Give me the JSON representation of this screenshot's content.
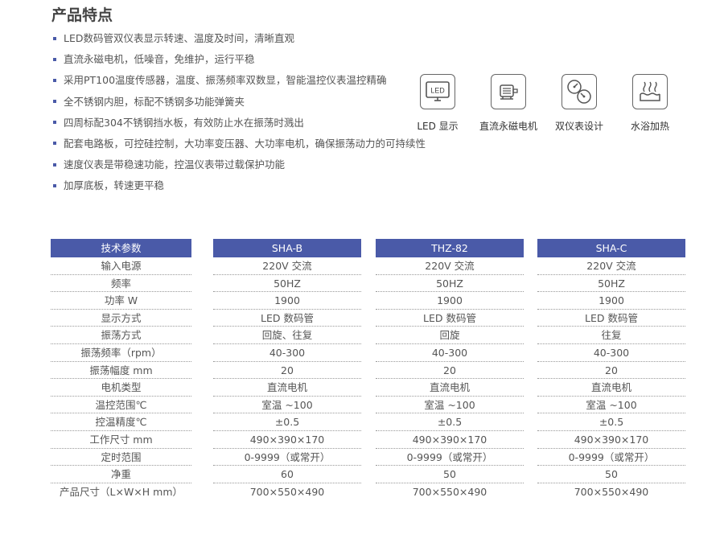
{
  "title": "产品特点",
  "features": [
    "LED数码管双仪表显示转速、温度及时间，清晰直观",
    "直流永磁电机，低噪音，免维护，运行平稳",
    "采用PT100温度传感器，温度、振荡频率双数显，智能温控仪表温控精确",
    "全不锈钢内胆，标配不锈钢多功能弹簧夹",
    "四周标配304不锈钢挡水板，有效防止水在振荡时溅出",
    "配套电路板，可控硅控制，大功率变压器、大功率电机，确保振荡动力的可持续性",
    "速度仪表是带稳速功能，控温仪表带过载保护功能",
    "加厚底板，转速更平稳"
  ],
  "icons": [
    {
      "label": "LED 显示",
      "icon": "led-display-icon",
      "text": "LED"
    },
    {
      "label": "直流永磁电机",
      "icon": "motor-icon"
    },
    {
      "label": "双仪表设计",
      "icon": "dual-gauge-icon"
    },
    {
      "label": "水浴加热",
      "icon": "water-bath-icon"
    }
  ],
  "table": {
    "headers": [
      "技术参数",
      "SHA-B",
      "THZ-82",
      "SHA-C"
    ],
    "rows": [
      [
        "输入电源",
        "220V 交流",
        "220V 交流",
        "220V 交流"
      ],
      [
        "频率",
        "50HZ",
        "50HZ",
        "50HZ"
      ],
      [
        "功率 W",
        "1900",
        "1900",
        "1900"
      ],
      [
        "显示方式",
        "LED 数码管",
        "LED 数码管",
        "LED 数码管"
      ],
      [
        "振荡方式",
        "回旋、往复",
        "回旋",
        "往复"
      ],
      [
        "振荡频率（rpm）",
        "40-300",
        "40-300",
        "40-300"
      ],
      [
        "振荡幅度 mm",
        "20",
        "20",
        "20"
      ],
      [
        "电机类型",
        "直流电机",
        "直流电机",
        "直流电机"
      ],
      [
        "温控范围℃",
        "室温 ~100",
        "室温 ~100",
        "室温 ~100"
      ],
      [
        "控温精度℃",
        "±0.5",
        "±0.5",
        "±0.5"
      ],
      [
        "工作尺寸 mm",
        "490×390×170",
        "490×390×170",
        "490×390×170"
      ],
      [
        "定时范围",
        "0-9999（或常开）",
        "0-9999（或常开）",
        "0-9999（或常开）"
      ],
      [
        "净重",
        "60",
        "50",
        "50"
      ],
      [
        "产品尺寸（L×W×H mm）",
        "700×550×490",
        "700×550×490",
        "700×550×490"
      ]
    ]
  },
  "colors": {
    "header_bg": "#4a5aa8",
    "bullet": "#4a5aa8"
  }
}
